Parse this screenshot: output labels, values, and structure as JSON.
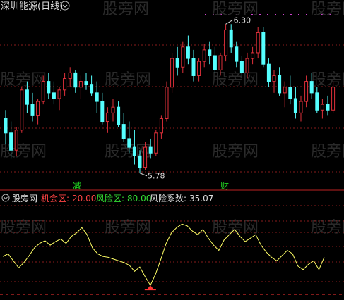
{
  "header": {
    "title": "深圳能源(日线)",
    "collapse_icon": "chevron-down-icon"
  },
  "watermark": {
    "text": "股旁网"
  },
  "main_panel": {
    "high_label": "6.30",
    "low_label": "5.78",
    "signal_reduce": "减",
    "signal_wealth": "财"
  },
  "indicator": {
    "name": "股旁网",
    "opportunity_label": "机会区:",
    "opportunity_value": "20.00",
    "risk_label": "风险区:",
    "risk_value": "80.00",
    "coef_label": "风险系数:",
    "coef_value": "35.07"
  },
  "colors": {
    "up": "#e0303a",
    "down": "#55ffff",
    "line": "#ffff66",
    "grid": "#8a1c1c",
    "opportunity": "#ff4444",
    "risk": "#33dd33",
    "text": "#dddddd",
    "signal": "#22dd22",
    "marker": "#ff3333"
  },
  "candles": [
    [
      5.97,
      6.0,
      5.88,
      5.92
    ],
    [
      5.92,
      5.96,
      5.83,
      5.86
    ],
    [
      5.86,
      5.94,
      5.84,
      5.93
    ],
    [
      5.93,
      6.08,
      5.92,
      6.07
    ],
    [
      6.07,
      6.1,
      5.99,
      6.02
    ],
    [
      6.02,
      6.06,
      5.96,
      5.98
    ],
    [
      5.98,
      6.04,
      5.95,
      6.03
    ],
    [
      6.03,
      6.12,
      6.02,
      6.1
    ],
    [
      6.1,
      6.13,
      6.04,
      6.06
    ],
    [
      6.06,
      6.1,
      6.02,
      6.04
    ],
    [
      6.04,
      6.08,
      6.0,
      6.07
    ],
    [
      6.07,
      6.13,
      6.05,
      6.11
    ],
    [
      6.11,
      6.15,
      6.08,
      6.13
    ],
    [
      6.13,
      6.14,
      6.06,
      6.08
    ],
    [
      6.08,
      6.12,
      6.04,
      6.1
    ],
    [
      6.1,
      6.13,
      6.07,
      6.09
    ],
    [
      6.09,
      6.12,
      6.05,
      6.06
    ],
    [
      6.06,
      6.1,
      5.99,
      6.03
    ],
    [
      6.03,
      6.06,
      5.95,
      5.96
    ],
    [
      5.96,
      6.01,
      5.92,
      5.99
    ],
    [
      5.99,
      6.04,
      5.96,
      6.01
    ],
    [
      6.01,
      6.03,
      5.94,
      5.95
    ],
    [
      5.95,
      5.99,
      5.89,
      5.9
    ],
    [
      5.9,
      5.96,
      5.85,
      5.87
    ],
    [
      5.87,
      5.93,
      5.81,
      5.84
    ],
    [
      5.84,
      5.86,
      5.78,
      5.8
    ],
    [
      5.8,
      5.89,
      5.79,
      5.87
    ],
    [
      5.87,
      5.9,
      5.83,
      5.85
    ],
    [
      5.85,
      5.93,
      5.84,
      5.92
    ],
    [
      5.92,
      5.98,
      5.9,
      5.97
    ],
    [
      5.97,
      6.1,
      5.96,
      6.08
    ],
    [
      6.08,
      6.2,
      6.06,
      6.18
    ],
    [
      6.18,
      6.22,
      6.12,
      6.15
    ],
    [
      6.15,
      6.24,
      6.13,
      6.22
    ],
    [
      6.22,
      6.26,
      6.16,
      6.18
    ],
    [
      6.18,
      6.21,
      6.1,
      6.12
    ],
    [
      6.12,
      6.18,
      6.1,
      6.17
    ],
    [
      6.17,
      6.23,
      6.15,
      6.21
    ],
    [
      6.21,
      6.24,
      6.16,
      6.19
    ],
    [
      6.19,
      6.22,
      6.13,
      6.14
    ],
    [
      6.14,
      6.2,
      6.12,
      6.19
    ],
    [
      6.19,
      6.3,
      6.17,
      6.28
    ],
    [
      6.28,
      6.3,
      6.2,
      6.22
    ],
    [
      6.22,
      6.24,
      6.15,
      6.17
    ],
    [
      6.17,
      6.19,
      6.12,
      6.13
    ],
    [
      6.13,
      6.2,
      6.11,
      6.18
    ],
    [
      6.18,
      6.22,
      6.16,
      6.2
    ],
    [
      6.2,
      6.29,
      6.18,
      6.27
    ],
    [
      6.27,
      6.29,
      6.15,
      6.16
    ],
    [
      6.16,
      6.18,
      6.08,
      6.1
    ],
    [
      6.1,
      6.14,
      6.06,
      6.12
    ],
    [
      6.12,
      6.15,
      6.05,
      6.06
    ],
    [
      6.06,
      6.1,
      6.01,
      6.08
    ],
    [
      6.08,
      6.12,
      6.02,
      6.04
    ],
    [
      6.04,
      6.08,
      5.97,
      5.99
    ],
    [
      5.99,
      6.05,
      5.96,
      6.03
    ],
    [
      6.03,
      6.12,
      6.01,
      6.1
    ],
    [
      6.1,
      6.13,
      6.04,
      6.06
    ],
    [
      6.06,
      6.08,
      5.99,
      6.0
    ],
    [
      6.0,
      6.04,
      5.97,
      6.02
    ],
    [
      6.02,
      6.05,
      5.98,
      6.0
    ],
    [
      6.0,
      6.1,
      5.99,
      6.08
    ]
  ],
  "indicator_series": [
    45,
    48,
    40,
    32,
    38,
    46,
    55,
    60,
    63,
    58,
    62,
    65,
    60,
    68,
    72,
    78,
    70,
    55,
    48,
    45,
    44,
    42,
    40,
    38,
    35,
    28,
    33,
    22,
    12,
    25,
    42,
    60,
    72,
    78,
    82,
    80,
    74,
    70,
    76,
    66,
    58,
    52,
    64,
    70,
    76,
    68,
    62,
    66,
    70,
    58,
    50,
    44,
    40,
    46,
    52,
    48,
    34,
    30,
    36,
    40,
    30,
    44
  ]
}
